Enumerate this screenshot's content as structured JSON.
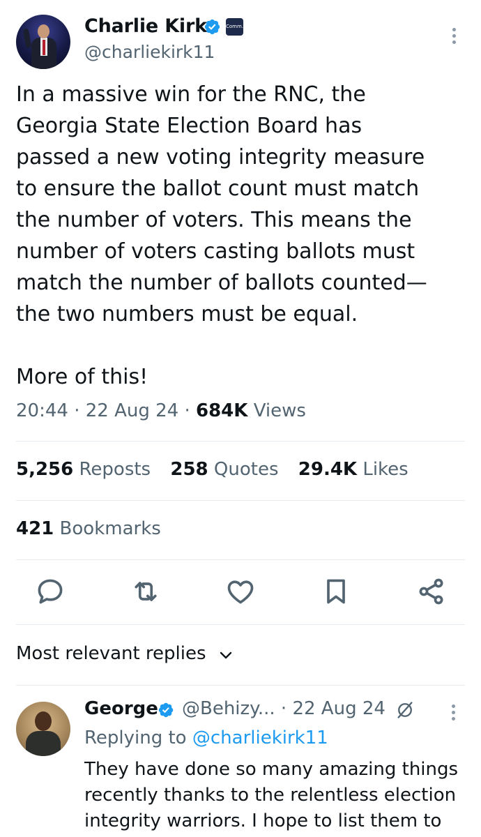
{
  "author": {
    "name": "Charlie Kirk",
    "handle": "@charliekirk11",
    "affiliate_badge_text": "Comm."
  },
  "tweet": {
    "text": "In a massive win for the RNC, the\nGeorgia State Election Board has\npassed a new voting integrity measure\nto ensure the ballot count must match\nthe number of voters. This means the\nnumber of voters casting ballots must\nmatch the number of ballots counted—\nthe two numbers must be equal.\n\nMore of this!",
    "time": "20:44",
    "date": "22 Aug 24",
    "views_count": "684K",
    "views_label": "Views",
    "separator": "·"
  },
  "stats": {
    "reposts_count": "5,256",
    "reposts_label": "Reposts",
    "quotes_count": "258",
    "quotes_label": "Quotes",
    "likes_count": "29.4K",
    "likes_label": "Likes",
    "bookmarks_count": "421",
    "bookmarks_label": "Bookmarks"
  },
  "actions": [
    "reply-icon",
    "repost-icon",
    "like-icon",
    "bookmark-icon",
    "share-icon"
  ],
  "colors": {
    "accent": "#1d9bf0",
    "muted": "#536471",
    "text": "#0f1419",
    "divider": "#e6ecf0"
  },
  "replies_sort": {
    "label": "Most relevant replies"
  },
  "reply": {
    "name": "George",
    "handle": "@Behizy...",
    "date": "· 22 Aug 24",
    "replying_prefix": "Replying to",
    "replying_to": "@charliekirk11",
    "text": "They have done so many amazing things\nrecently thanks to the relentless election\nintegrity warriors. I hope to list them to"
  }
}
